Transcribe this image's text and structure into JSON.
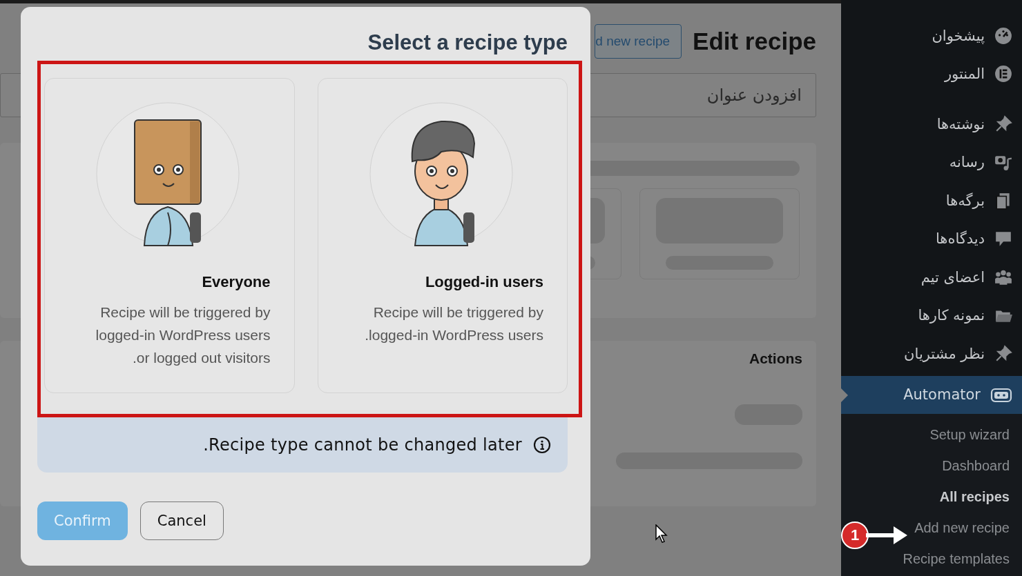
{
  "page": {
    "title": "Edit recipe",
    "add_button": "d new recipe",
    "title_field": {
      "placeholder": "افزودن عنوان"
    },
    "actions_panel": {
      "title": "Actions"
    }
  },
  "sidebar": {
    "menu_groups": [
      [
        {
          "label": "پیشخوان",
          "selected": false
        },
        {
          "label": "المنتور",
          "selected": false
        }
      ],
      [
        {
          "label": "نوشته‌ها",
          "selected": false
        },
        {
          "label": "رسانه",
          "selected": false
        },
        {
          "label": "برگه‌ها",
          "selected": false
        },
        {
          "label": "دیدگاه‌ها",
          "selected": false
        },
        {
          "label": "اعضای تیم",
          "selected": false
        },
        {
          "label": "نمونه کارها",
          "selected": false
        },
        {
          "label": "نظر مشتریان",
          "selected": false
        },
        {
          "label": "Automator",
          "selected": true
        }
      ]
    ],
    "submenu": [
      {
        "label": "Setup wizard",
        "selected": false
      },
      {
        "label": "Dashboard",
        "selected": false
      },
      {
        "label": "All recipes",
        "selected": true
      },
      {
        "label": "Add new recipe",
        "selected": false
      },
      {
        "label": "Recipe templates",
        "selected": false
      }
    ]
  },
  "modal": {
    "title": "Select a recipe type",
    "options": [
      {
        "kind": "boy",
        "title": "Logged-in users",
        "description": "Recipe will be triggered by .logged-in WordPress users",
        "selected": false
      },
      {
        "kind": "bag",
        "title": "Everyone",
        "description": "Recipe will be triggered by logged-in WordPress users .or logged out visitors",
        "selected": false
      }
    ],
    "notice": ".Recipe type cannot be changed later",
    "buttons": [
      {
        "label": "Cancel",
        "kind": "secondary",
        "disabled": false
      },
      {
        "label": "Confirm",
        "kind": "primary",
        "disabled": true
      }
    ]
  },
  "annotation": {
    "badge": "1"
  }
}
